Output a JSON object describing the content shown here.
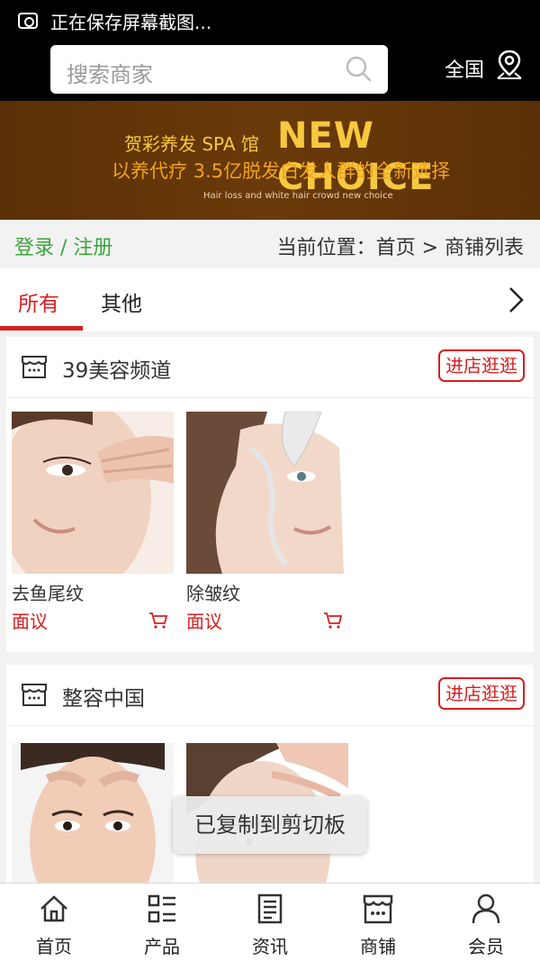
{
  "status": {
    "text": "正在保存屏幕截图..."
  },
  "header": {
    "search_placeholder": "搜索商家",
    "region": "全国"
  },
  "banner": {
    "line1": "贺彩养发 SPA 馆",
    "line2": "NEW CHOICE",
    "line3": "以养代疗 3.5亿脱发白发人群的全新选择",
    "line4": "Hair loss and white hair crowd new choice"
  },
  "breadcrumb": {
    "login": "登录 / 注册",
    "path": "当前位置：首页 > 商铺列表"
  },
  "tabs": [
    {
      "label": "所有",
      "active": true
    },
    {
      "label": "其他",
      "active": false
    }
  ],
  "shops": [
    {
      "name": "39美容频道",
      "visit_label": "进店逛逛",
      "products": [
        {
          "name": "去鱼尾纹",
          "price": "面议"
        },
        {
          "name": "除皱纹",
          "price": "面议"
        }
      ]
    },
    {
      "name": "整容中国",
      "visit_label": "进店逛逛",
      "products": [
        {
          "name": "",
          "price": ""
        },
        {
          "name": "",
          "price": ""
        }
      ]
    }
  ],
  "toast": "已复制到剪切板",
  "nav": [
    {
      "label": "首页",
      "icon": "home-icon"
    },
    {
      "label": "产品",
      "icon": "grid-list-icon"
    },
    {
      "label": "资讯",
      "icon": "document-icon"
    },
    {
      "label": "商铺",
      "icon": "store-icon"
    },
    {
      "label": "会员",
      "icon": "user-icon"
    }
  ],
  "colors": {
    "accent": "#d81e1e",
    "login": "#3aa63a",
    "banner": "#5a3006"
  }
}
